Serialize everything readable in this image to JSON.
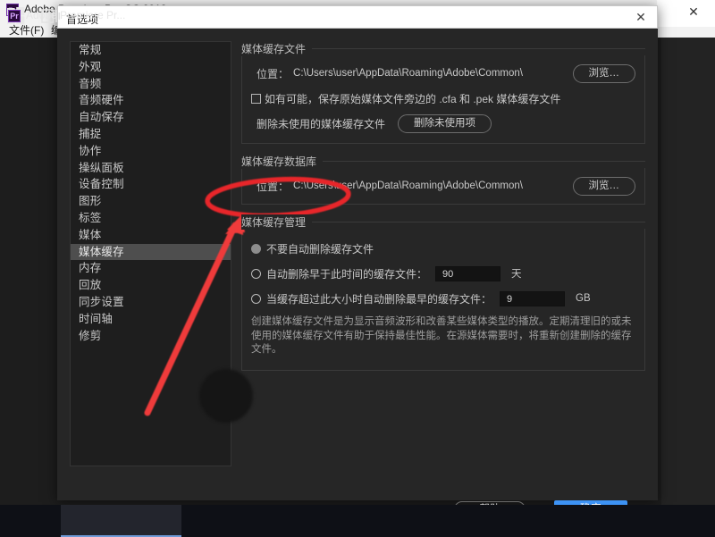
{
  "background_window": {
    "title": "Adobe Premiere Pro CC 2018",
    "app_icon": "Pr",
    "close_icon": "✕",
    "menus": [
      {
        "label": "文件(F)",
        "x": 10
      },
      {
        "label": "编辑",
        "x": 57
      }
    ]
  },
  "second_window": {
    "close_icon": "✕"
  },
  "dialog": {
    "title": "首选项",
    "close_icon": "✕",
    "sidebar": {
      "items": [
        {
          "label": "常规",
          "selected": false
        },
        {
          "label": "外观",
          "selected": false
        },
        {
          "label": "音频",
          "selected": false
        },
        {
          "label": "音频硬件",
          "selected": false
        },
        {
          "label": "自动保存",
          "selected": false
        },
        {
          "label": "捕捉",
          "selected": false
        },
        {
          "label": "协作",
          "selected": false
        },
        {
          "label": "操纵面板",
          "selected": false
        },
        {
          "label": "设备控制",
          "selected": false
        },
        {
          "label": "图形",
          "selected": false
        },
        {
          "label": "标签",
          "selected": false
        },
        {
          "label": "媒体",
          "selected": false
        },
        {
          "label": "媒体缓存",
          "selected": true
        },
        {
          "label": "内存",
          "selected": false
        },
        {
          "label": "回放",
          "selected": false
        },
        {
          "label": "同步设置",
          "selected": false
        },
        {
          "label": "时间轴",
          "selected": false
        },
        {
          "label": "修剪",
          "selected": false
        }
      ]
    },
    "media_cache_files": {
      "title": "媒体缓存文件",
      "location_label": "位置：",
      "location_path": "C:\\Users\\user\\AppData\\Roaming\\Adobe\\Common\\",
      "browse_label": "浏览…",
      "checkbox_label": "如有可能，保存原始媒体文件旁边的 .cfa 和 .pek 媒体缓存文件",
      "checkbox_checked": false,
      "delete_unused_label": "删除未使用的媒体缓存文件",
      "delete_unused_button": "删除未使用项"
    },
    "media_cache_database": {
      "title": "媒体缓存数据库",
      "location_label": "位置：",
      "location_path": "C:\\Users\\user\\AppData\\Roaming\\Adobe\\Common\\",
      "browse_label": "浏览…"
    },
    "media_cache_management": {
      "title": "媒体缓存管理",
      "options": [
        {
          "label": "不要自动删除缓存文件",
          "selected": true
        },
        {
          "label": "自动删除早于此时间的缓存文件：",
          "selected": false,
          "value": "90",
          "unit": "天"
        },
        {
          "label": "当缓存超过此大小时自动删除最早的缓存文件：",
          "selected": false,
          "value": "9",
          "unit": "GB"
        }
      ],
      "description": "创建媒体缓存文件是为显示音频波形和改善某些媒体类型的播放。定期清理旧的或未使用的媒体缓存文件有助于保持最佳性能。在源媒体需要时，将重新创建删除的缓存文件。"
    },
    "footer": {
      "help_label": "帮助",
      "ok_label": "确定"
    }
  },
  "annotations": {
    "ellipse_color": "#e8252b",
    "arrow_color": "#ef3b3b",
    "ellipse_target": "媒体缓存管理"
  },
  "taskbar": {
    "start_icon": "windows-logo",
    "taskview_icon": "task-view",
    "items": [
      {
        "label": "Adobe Premiere Pr...",
        "icon": "Pr",
        "active": true
      }
    ]
  }
}
